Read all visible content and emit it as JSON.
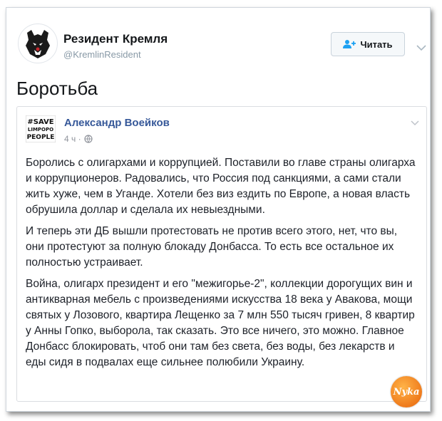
{
  "tweet": {
    "author_name": "Резидент Кремля",
    "author_handle": "@KremlinResident",
    "follow_label": "Читать",
    "text": "Боротьба"
  },
  "embed": {
    "logo_lines": [
      "#SAVE",
      "LIMPOPO",
      "PEOPLE"
    ],
    "author": "Александр Воейков",
    "time": "4 ч ·",
    "paragraphs": [
      "Боролись с олигархами и коррупцией. Поставили во главе страны олигарха и коррупционеров. Радовались, что Россия под санкциями, а сами стали жить хуже, чем в Уганде. Хотели без виз ездить по Европе, а новая власть обрушила доллар и сделала их невыездными.",
      "И теперь эти ДБ вышли протестовать не против всего этого, нет, что вы, они протестуют за полную блокаду Донбасса. То есть все остальное их полностью устраивает.",
      "Война, олигарх президент и его \"межигорье-2\", коллекции дорогущих вин и антикварная мебель с произведениями искусства 18 века у Авакова, мощи святых у Лозового, квартира Лещенко за 7 млн 550 тысяч гривен, 8 квартир у Анны Гопко, выборола, так сказать. Это все ничего, это можно. Главное Донбасс блокировать, чтоб они там без света, без воды, без лекарств и еды сидя в подвалах еще сильнее полюбили Украину."
    ]
  },
  "watermark": {
    "text": "Nyka"
  },
  "colors": {
    "link": "#365899",
    "text": "#1d2129",
    "muted": "#90949c",
    "follow_icon": "#1da1f2"
  }
}
